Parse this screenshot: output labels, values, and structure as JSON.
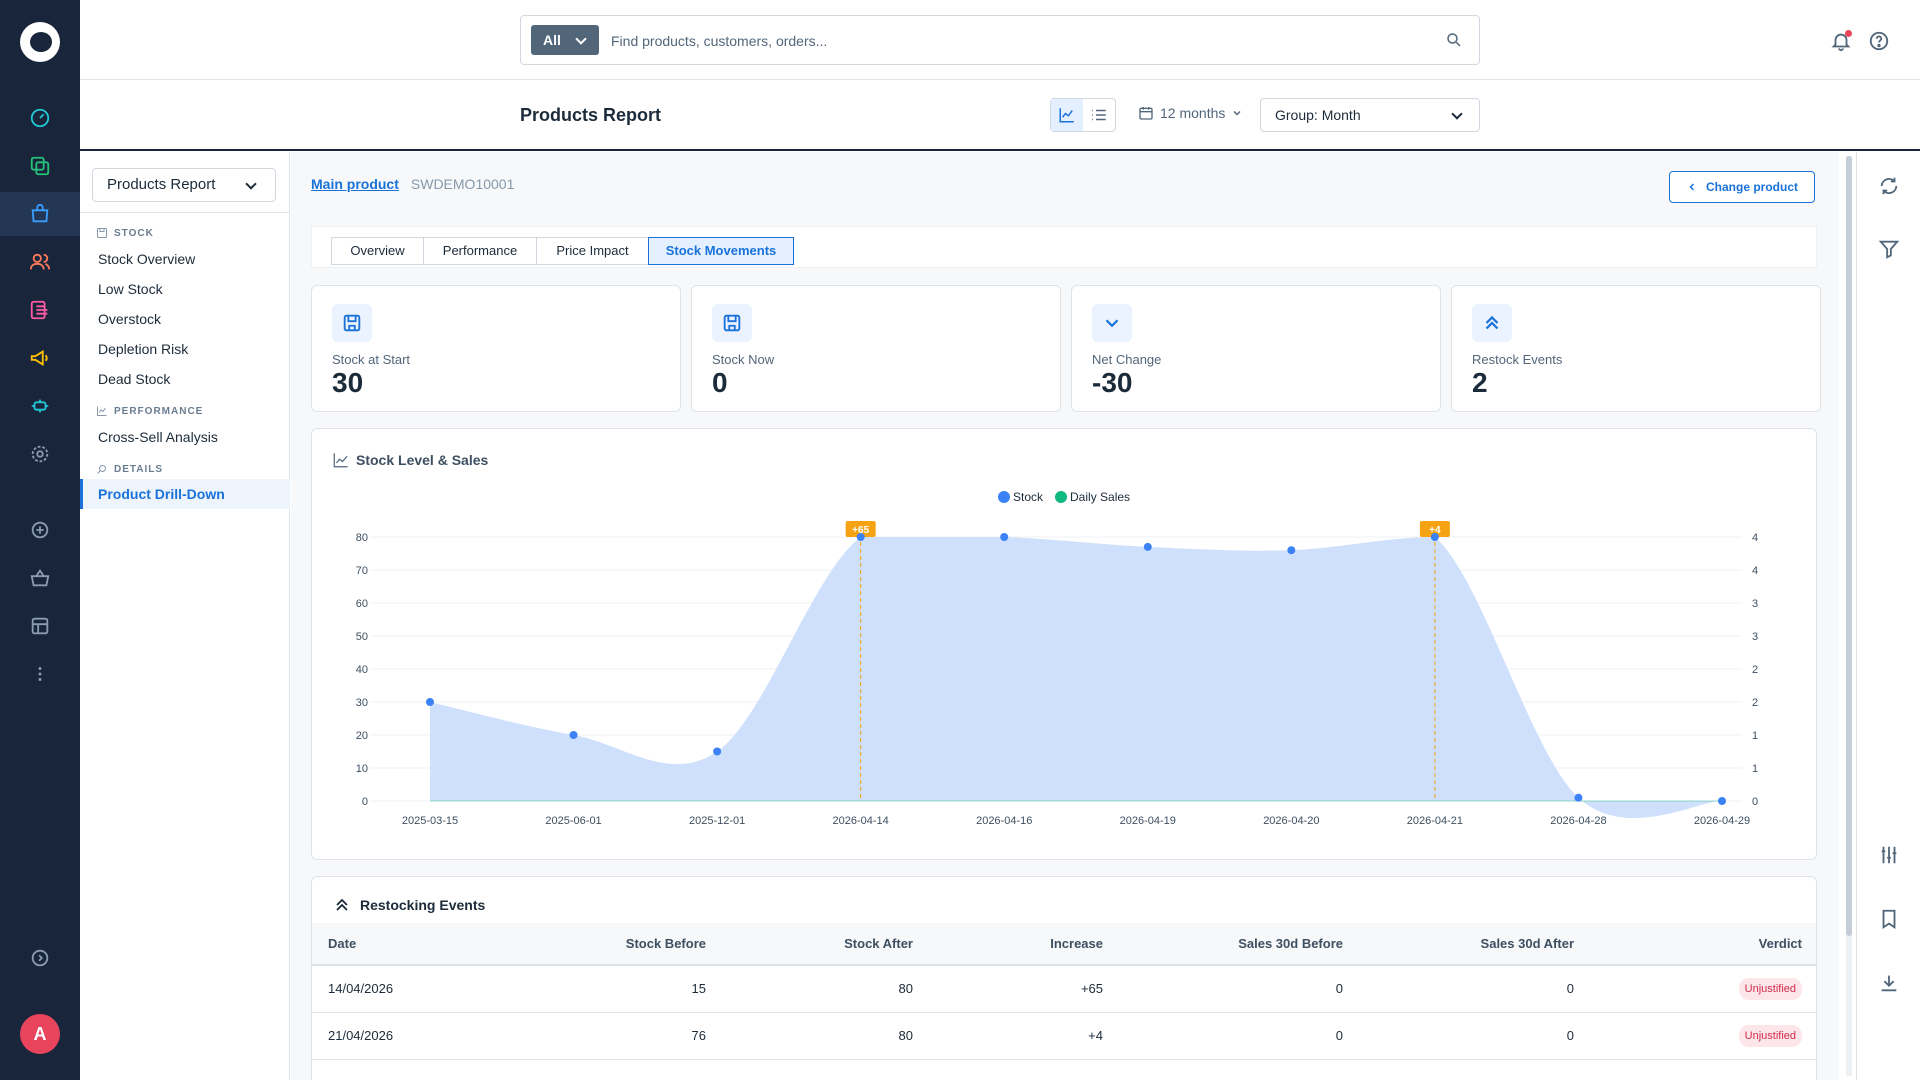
{
  "search": {
    "scope": "All",
    "placeholder": "Find products, customers, orders..."
  },
  "header": {
    "title": "Products Report",
    "period": "12 months",
    "group": "Group: Month"
  },
  "sidebar": {
    "report_select": "Products Report",
    "sections": [
      {
        "title": "STOCK",
        "items": [
          "Stock Overview",
          "Low Stock",
          "Overstock",
          "Depletion Risk",
          "Dead Stock"
        ]
      },
      {
        "title": "PERFORMANCE",
        "items": [
          "Cross-Sell Analysis"
        ]
      },
      {
        "title": "DETAILS",
        "items": [
          "Product Drill-Down"
        ]
      }
    ],
    "active_item": "Product Drill-Down"
  },
  "product": {
    "link": "Main product",
    "sku": "SWDEMO10001",
    "change_button": "Change product"
  },
  "tabs": [
    "Overview",
    "Performance",
    "Price Impact",
    "Stock Movements"
  ],
  "active_tab": "Stock Movements",
  "kpis": [
    {
      "label": "Stock at Start",
      "value": "30",
      "icon": "save-icon"
    },
    {
      "label": "Stock Now",
      "value": "0",
      "icon": "save-icon"
    },
    {
      "label": "Net Change",
      "value": "-30",
      "icon": "chevron-down-icon"
    },
    {
      "label": "Restock Events",
      "value": "2",
      "icon": "double-chevron-up-icon"
    }
  ],
  "chart_title": "Stock Level & Sales",
  "chart_data": {
    "type": "area",
    "title": "Stock Level & Sales",
    "categories": [
      "2025-03-15",
      "2025-06-01",
      "2025-12-01",
      "2026-04-14",
      "2026-04-16",
      "2026-04-19",
      "2026-04-20",
      "2026-04-21",
      "2026-04-28",
      "2026-04-29"
    ],
    "series": [
      {
        "name": "Stock",
        "values": [
          30,
          20,
          15,
          80,
          80,
          77,
          76,
          80,
          1,
          0
        ],
        "color": "#3b82f6"
      },
      {
        "name": "Daily Sales",
        "values": [
          0,
          0,
          0,
          0,
          0,
          0,
          0,
          0,
          0,
          0
        ],
        "color": "#10b981"
      }
    ],
    "ylim": [
      0,
      80
    ],
    "yticks": [
      0,
      10,
      20,
      30,
      40,
      50,
      60,
      70,
      80
    ],
    "y2ticks": [
      "0",
      "1",
      "1",
      "2",
      "2",
      "3",
      "3",
      "4",
      "4"
    ],
    "annotations": [
      {
        "category": "2026-04-14",
        "label": "+65"
      },
      {
        "category": "2026-04-21",
        "label": "+4"
      }
    ],
    "legend_position": "top-center",
    "grid": true
  },
  "events": {
    "title": "Restocking Events",
    "columns": [
      "Date",
      "Stock Before",
      "Stock After",
      "Increase",
      "Sales 30d Before",
      "Sales 30d After",
      "Verdict"
    ],
    "rows": [
      [
        "14/04/2026",
        "15",
        "80",
        "+65",
        "0",
        "0",
        "Unjustified"
      ],
      [
        "21/04/2026",
        "76",
        "80",
        "+4",
        "0",
        "0",
        "Unjustified"
      ]
    ]
  },
  "user": {
    "avatar_initial": "A"
  },
  "colors": {
    "nav_bg": "#18253a",
    "accent": "#1a72d9",
    "stock_area": "#cfe0fc",
    "restock_marker": "#f5a312",
    "danger": "#d12c4a"
  }
}
